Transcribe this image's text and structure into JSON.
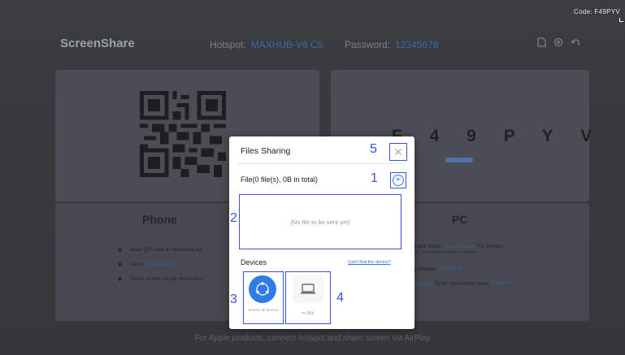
{
  "screen": {
    "code_label": "Code: F49PYV"
  },
  "header": {
    "brand": "ScreenShare",
    "hotspot_label": "Hotspot:",
    "hotspot_value": "MAXHUB-V6 C5",
    "password_label": "Password:",
    "password_value": "12345678",
    "icons": [
      "file-icon",
      "settings-icon",
      "back-icon"
    ]
  },
  "connection_code": "F 4 9 P Y V",
  "phone": {
    "title": "Phone",
    "steps": [
      {
        "text": "Scan QR code to download ap"
      },
      {
        "text": "Open ",
        "link": "Screenshare"
      },
      {
        "text": "Share screen as per the instruc"
      }
    ]
  },
  "pc": {
    "title": "PC",
    "step1_prefix": "d and install ",
    "step1_link": "Screenshare",
    "step1_suffix": " PC version",
    "step1_sub": "link: https://www.maxhub.com/share",
    "step2_prefix": "o network: ",
    "step2_link": "CVTE-HK",
    "step3_link": "enshare",
    "step3_text": " Enter connection code: ",
    "step3_code": "F49PYV"
  },
  "footer": "For Apple products, connect hotspot and share screen via AirPlay",
  "dialog": {
    "title": "Files Sharing",
    "file_summary": "File(0 file(s), 0B in total)",
    "empty_text": "(No file to be sent yet)",
    "devices_label": "Devices",
    "cant_find": "Can't find the device?",
    "send_all_label": "Send to all devices",
    "pc_label": "PC测试"
  },
  "markers": [
    "1",
    "2",
    "3",
    "4",
    "5"
  ]
}
